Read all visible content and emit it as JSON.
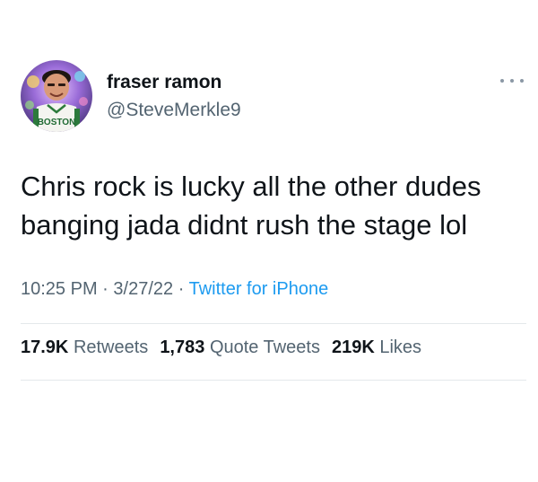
{
  "author": {
    "name": "fraser ramon",
    "handle": "@SteveMerkle9",
    "avatar_jersey_text": "BOSTON"
  },
  "tweet": {
    "text_line1": "Chris rock is lucky all the other dudes",
    "text_line2": "banging jada didnt rush the stage lol"
  },
  "meta": {
    "time": "10:25 PM",
    "separator": "·",
    "date": "3/27/22",
    "source": "Twitter for iPhone"
  },
  "stats": {
    "retweets_count": "17.9K",
    "retweets_label": "Retweets",
    "quotes_count": "1,783",
    "quotes_label": "Quote Tweets",
    "likes_count": "219K",
    "likes_label": "Likes"
  },
  "icons": {
    "more": "more-horizontal-icon"
  },
  "colors": {
    "text_primary": "#0f1419",
    "text_secondary": "#536471",
    "link": "#1d9bf0",
    "divider": "#e4e8eb"
  }
}
